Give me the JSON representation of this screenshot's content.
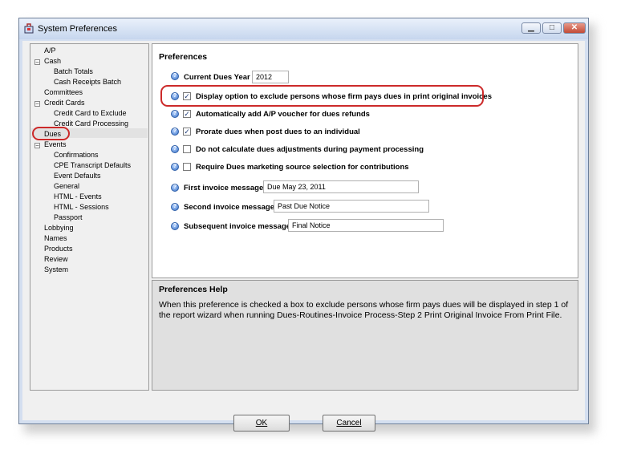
{
  "window": {
    "title": "System Preferences",
    "minimize_icon": "minimize-icon",
    "maximize_icon": "maximize-icon",
    "close_icon": "close-icon"
  },
  "tree": {
    "items": [
      {
        "label": "A/P",
        "level": 0,
        "expander": ""
      },
      {
        "label": "Cash",
        "level": 0,
        "expander": "−"
      },
      {
        "label": "Batch Totals",
        "level": 1,
        "expander": ""
      },
      {
        "label": "Cash Receipts Batch",
        "level": 1,
        "expander": ""
      },
      {
        "label": "Committees",
        "level": 0,
        "expander": ""
      },
      {
        "label": "Credit Cards",
        "level": 0,
        "expander": "−"
      },
      {
        "label": "Credit Card to Exclude",
        "level": 1,
        "expander": ""
      },
      {
        "label": "Credit Card Processing",
        "level": 1,
        "expander": ""
      },
      {
        "label": "Dues",
        "level": 0,
        "expander": ""
      },
      {
        "label": "Events",
        "level": 0,
        "expander": "−"
      },
      {
        "label": "Confirmations",
        "level": 1,
        "expander": ""
      },
      {
        "label": "CPE Transcript Defaults",
        "level": 1,
        "expander": ""
      },
      {
        "label": "Event Defaults",
        "level": 1,
        "expander": ""
      },
      {
        "label": "General",
        "level": 1,
        "expander": ""
      },
      {
        "label": "HTML - Events",
        "level": 1,
        "expander": ""
      },
      {
        "label": "HTML - Sessions",
        "level": 1,
        "expander": ""
      },
      {
        "label": "Passport",
        "level": 1,
        "expander": ""
      },
      {
        "label": "Lobbying",
        "level": 0,
        "expander": ""
      },
      {
        "label": "Names",
        "level": 0,
        "expander": ""
      },
      {
        "label": "Products",
        "level": 0,
        "expander": ""
      },
      {
        "label": "Review",
        "level": 0,
        "expander": ""
      },
      {
        "label": "System",
        "level": 0,
        "expander": ""
      }
    ],
    "selected": "Dues"
  },
  "preferences": {
    "title": "Preferences",
    "current_dues_year_label": "Current Dues Year",
    "current_dues_year_value": "2012",
    "options": [
      {
        "label": "Display option to exclude persons whose firm pays dues in print original invoices",
        "checked": true
      },
      {
        "label": "Automatically add A/P voucher for dues refunds",
        "checked": true
      },
      {
        "label": "Prorate dues when post dues to an individual",
        "checked": true
      },
      {
        "label": "Do not calculate dues adjustments during payment processing",
        "checked": false
      },
      {
        "label": "Require Dues marketing source selection for contributions",
        "checked": false
      }
    ],
    "first_invoice_label": "First invoice message",
    "first_invoice_value": "Due May 23, 2011",
    "second_invoice_label": "Second invoice message",
    "second_invoice_value": "Past Due Notice",
    "subsequent_invoice_label": "Subsequent invoice message",
    "subsequent_invoice_value": "Final Notice"
  },
  "help": {
    "title": "Preferences Help",
    "text": "When this preference is checked a box to exclude persons whose firm pays dues will be displayed in step 1 of the report wizard when running Dues-Routines-Invoice Process-Step 2 Print Original Invoice From Print File."
  },
  "buttons": {
    "ok": "OK",
    "cancel": "Cancel"
  },
  "colors": {
    "highlight": "#cc2a2a",
    "title_gradient_top": "#eaf1fb",
    "title_gradient_bottom": "#c6d6ee"
  }
}
